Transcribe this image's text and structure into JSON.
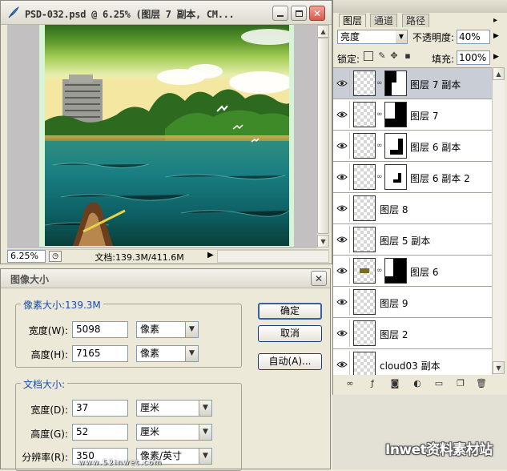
{
  "document_window": {
    "title": "PSD-032.psd @ 6.25% (图层 7 副本, CM...",
    "zoom": "6.25%",
    "doc_size": "文档:139.3M/411.6M"
  },
  "image_size_dialog": {
    "title": "图像大小",
    "pixel_dimensions": {
      "label": "像素大小:139.3M",
      "width_label": "宽度(W):",
      "width_value": "5098",
      "width_unit": "像素",
      "height_label": "高度(H):",
      "height_value": "7165",
      "height_unit": "像素"
    },
    "document_size": {
      "label": "文档大小:",
      "width_label": "宽度(D):",
      "width_value": "37",
      "width_unit": "厘米",
      "height_label": "高度(G):",
      "height_value": "52",
      "height_unit": "厘米",
      "resolution_label": "分辨率(R):",
      "resolution_value": "350",
      "resolution_unit": "像素/英寸"
    },
    "buttons": {
      "ok": "确定",
      "cancel": "取消",
      "auto": "自动(A)..."
    }
  },
  "layers_panel": {
    "tabs": [
      "图层",
      "通道",
      "路径"
    ],
    "blend_mode": "亮度",
    "opacity_label": "不透明度:",
    "opacity_value": "40%",
    "lock_label": "锁定:",
    "fill_label": "填充:",
    "fill_value": "100%",
    "layers": [
      {
        "name": "图层 7 副本",
        "selected": true,
        "has_mask": true
      },
      {
        "name": "图层 7",
        "selected": false,
        "has_mask": true
      },
      {
        "name": "图层 6 副本",
        "selected": false,
        "has_mask": true
      },
      {
        "name": "图层 6 副本 2",
        "selected": false,
        "has_mask": true
      },
      {
        "name": "图层 8",
        "selected": false,
        "has_mask": false
      },
      {
        "name": "图层 5 副本",
        "selected": false,
        "has_mask": false
      },
      {
        "name": "图层 6",
        "selected": false,
        "has_mask": true
      },
      {
        "name": "图层 9",
        "selected": false,
        "has_mask": false
      },
      {
        "name": "图层 2",
        "selected": false,
        "has_mask": false
      },
      {
        "name": "cloud03 副本",
        "selected": false,
        "has_mask": false
      }
    ]
  },
  "watermark": {
    "logo": "Inwet资料素材站",
    "url": "www.52inwet.com"
  }
}
